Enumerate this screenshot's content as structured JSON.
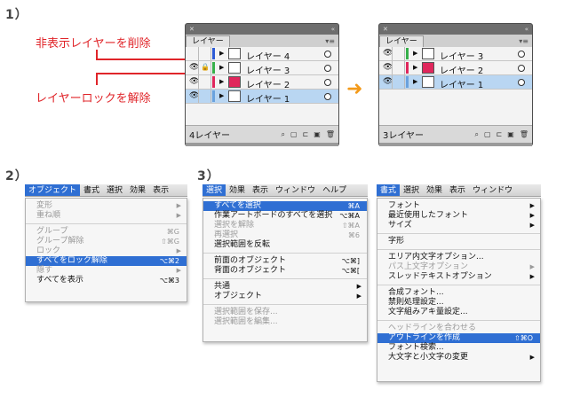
{
  "steps": {
    "s1": "1）",
    "s2": "2）",
    "s3": "3）"
  },
  "annotations": {
    "delete_hidden": "非表示レイヤーを削除",
    "unlock": "レイヤーロックを解除"
  },
  "panel_before": {
    "tab": "レイヤー",
    "layers": [
      {
        "name": "レイヤー 4",
        "visible": false,
        "locked": false,
        "color": "#2d5bd6",
        "thumb_color": "#ffffff",
        "selected": false
      },
      {
        "name": "レイヤー 3",
        "visible": true,
        "locked": true,
        "color": "#36b04a",
        "thumb_color": "#ffffff",
        "selected": false
      },
      {
        "name": "レイヤー 2",
        "visible": true,
        "locked": false,
        "color": "#e0265c",
        "thumb_color": "#e0265c",
        "selected": false
      },
      {
        "name": "レイヤー 1",
        "visible": true,
        "locked": false,
        "color": "#6aa2de",
        "thumb_color": "#ffffff",
        "selected": true
      }
    ],
    "count": "4レイヤー"
  },
  "panel_after": {
    "tab": "レイヤー",
    "layers": [
      {
        "name": "レイヤー 3",
        "visible": true,
        "locked": false,
        "color": "#36b04a",
        "thumb_color": "#ffffff",
        "selected": false
      },
      {
        "name": "レイヤー 2",
        "visible": true,
        "locked": false,
        "color": "#e0265c",
        "thumb_color": "#e0265c",
        "selected": false
      },
      {
        "name": "レイヤー 1",
        "visible": true,
        "locked": false,
        "color": "#6aa2de",
        "thumb_color": "#ffffff",
        "selected": true
      }
    ],
    "count": "3レイヤー"
  },
  "menu_object": {
    "bar": [
      "オブジェクト",
      "書式",
      "選択",
      "効果",
      "表示"
    ],
    "active": 0,
    "items": [
      {
        "label": "変形",
        "disabled": true,
        "submenu": true
      },
      {
        "label": "重ね順",
        "disabled": true,
        "submenu": true
      },
      {
        "sep": true
      },
      {
        "label": "グループ",
        "disabled": true,
        "shortcut": "⌘G"
      },
      {
        "label": "グループ解除",
        "disabled": true,
        "shortcut": "⇧⌘G"
      },
      {
        "label": "ロック",
        "disabled": true,
        "submenu": true
      },
      {
        "label": "すべてをロック解除",
        "highlight": true,
        "shortcut": "⌥⌘2"
      },
      {
        "label": "隠す",
        "disabled": true,
        "submenu": true
      },
      {
        "label": "すべてを表示",
        "shortcut": "⌥⌘3"
      }
    ]
  },
  "menu_select": {
    "bar": [
      "選択",
      "効果",
      "表示",
      "ウィンドウ",
      "ヘルプ"
    ],
    "active": 0,
    "items": [
      {
        "label": "すべてを選択",
        "highlight": true,
        "shortcut": "⌘A"
      },
      {
        "label": "作業アートボードのすべてを選択",
        "shortcut": "⌥⌘A"
      },
      {
        "label": "選択を解除",
        "disabled": true,
        "shortcut": "⇧⌘A"
      },
      {
        "label": "再選択",
        "disabled": true,
        "shortcut": "⌘6"
      },
      {
        "label": "選択範囲を反転"
      },
      {
        "sep": true
      },
      {
        "label": "前面のオブジェクト",
        "shortcut": "⌥⌘]"
      },
      {
        "label": "背面のオブジェクト",
        "shortcut": "⌥⌘["
      },
      {
        "sep": true
      },
      {
        "label": "共通",
        "submenu": true
      },
      {
        "label": "オブジェクト",
        "submenu": true
      },
      {
        "sep": true
      },
      {
        "label": "選択範囲を保存...",
        "disabled": true
      },
      {
        "label": "選択範囲を編集...",
        "disabled": true
      }
    ]
  },
  "menu_type": {
    "bar": [
      "書式",
      "選択",
      "効果",
      "表示",
      "ウィンドウ"
    ],
    "active": 0,
    "items": [
      {
        "label": "フォント",
        "submenu": true
      },
      {
        "label": "最近使用したフォント",
        "submenu": true
      },
      {
        "label": "サイズ",
        "submenu": true
      },
      {
        "sep": true
      },
      {
        "label": "字形"
      },
      {
        "sep": true
      },
      {
        "label": "エリア内文字オプション..."
      },
      {
        "label": "パス上文字オプション",
        "disabled": true,
        "submenu": true
      },
      {
        "label": "スレッドテキストオプション",
        "submenu": true
      },
      {
        "sep": true
      },
      {
        "label": "合成フォント..."
      },
      {
        "label": "禁則処理設定..."
      },
      {
        "label": "文字組みアキ量設定..."
      },
      {
        "sep": true
      },
      {
        "label": "ヘッドラインを合わせる",
        "disabled": true
      },
      {
        "label": "アウトラインを作成",
        "highlight": true,
        "shortcut": "⇧⌘O"
      },
      {
        "label": "フォント検索..."
      },
      {
        "label": "大文字と小文字の変更",
        "submenu": true
      }
    ]
  }
}
